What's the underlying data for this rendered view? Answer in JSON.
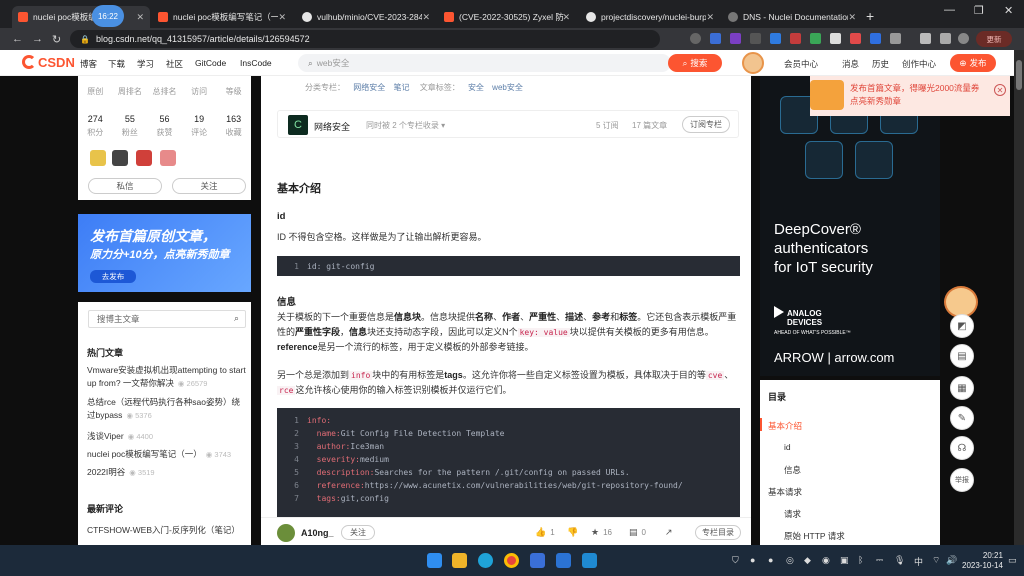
{
  "browser": {
    "tabs": [
      {
        "label": "nuclei poc模板编写笔记",
        "active": true
      },
      {
        "label": "nuclei poc模板编写笔记（一）"
      },
      {
        "label": "vulhub/minio/CVE-2023-2843"
      },
      {
        "label": "(CVE-2022-30525) Zyxel 防"
      },
      {
        "label": "projectdiscovery/nuclei-burp"
      },
      {
        "label": "DNS - Nuclei Documentation"
      }
    ],
    "tab_time_badge": "16:22",
    "url": "blog.csdn.net/qq_41315957/article/details/126594572",
    "update_button": "更新",
    "new_tab": "+",
    "window_controls": [
      "—",
      "❐",
      "✕"
    ]
  },
  "csdn": {
    "logo": "CSDN",
    "nav": [
      "博客",
      "下载",
      "学习",
      "社区",
      "GitCode",
      "InsCode"
    ],
    "search_placeholder": "web安全",
    "search_button": "搜索",
    "right_nav": [
      "会员中心",
      "消息",
      "历史",
      "创作中心"
    ],
    "publish_button": "发布"
  },
  "profile": {
    "top_stats": [
      {
        "value": "",
        "label": "原创"
      },
      {
        "value": "",
        "label": "周排名"
      },
      {
        "value": "",
        "label": "总排名"
      },
      {
        "value": "",
        "label": "访问"
      },
      {
        "value": "",
        "label": "等级"
      }
    ],
    "stats": [
      {
        "value": "274",
        "label": "积分"
      },
      {
        "value": "55",
        "label": "粉丝"
      },
      {
        "value": "56",
        "label": "获赞"
      },
      {
        "value": "19",
        "label": "评论"
      },
      {
        "value": "163",
        "label": "收藏"
      }
    ],
    "message_button": "私信",
    "follow_button": "关注"
  },
  "left_ad": {
    "line1": "发布首篇原创文章，",
    "line2": "原力分+10分，点亮新秀勋章",
    "button": "去发布"
  },
  "blog_search_placeholder": "搜博主文章",
  "hot_title": "热门文章",
  "hot_articles": [
    {
      "title": "Vmware安装虚拟机出现attempting to start up from? 一文帮你解决",
      "views": "26579"
    },
    {
      "title": "总结rce（远程代码执行各种sao姿势）绕过bypass",
      "views": "5376"
    },
    {
      "title": "浅谈Viper",
      "views": "4400"
    },
    {
      "title": "nuclei poc模板编写笔记（一）",
      "views": "3743"
    },
    {
      "title": "2022I明谷",
      "views": "3519"
    }
  ],
  "latest_comments_title": "最新评论",
  "latest_comment_preview": "CTFSHOW-WEB入门-反序列化（笔记）",
  "article": {
    "category_label": "分类专栏：",
    "categories": [
      "网络安全",
      "笔记"
    ],
    "tags_label": "文章标签：",
    "tags": [
      "安全",
      "web安全"
    ],
    "column_icon": "C",
    "column_name": "网络安全",
    "column_sub": "同时被 2 个专栏收录 ▾",
    "column_subs": "5 订阅",
    "column_articles": "17 篇文章",
    "subscribe_button": "订阅专栏",
    "h_basic": "基本介绍",
    "h_id": "id",
    "p_id": "ID 不得包含空格。这样做是为了让输出解析更容易。",
    "code1_ln": "1",
    "code1": "id: git-config",
    "h_info": "信息",
    "p_info_1": "关于模板的下一个重要信息是",
    "p_info_b1": "信息块",
    "p_info_2": "。信息块提供",
    "p_info_b2": "名称",
    "p_info_3": "、",
    "p_info_b3": "作者",
    "p_info_4": "、",
    "p_info_b4": "严重性",
    "p_info_5": "、",
    "p_info_b5": "描述",
    "p_info_6": "、",
    "p_info_b6": "参考",
    "p_info_7": "和",
    "p_info_b7": "标签",
    "p_info_8": "。它还包含表示模板严重性的",
    "p_info_b8": "严重性字段",
    "p_info_9": "，",
    "p_info_b9": "信息",
    "p_info_10": "块还支持动态字段，因此可以定义N个",
    "p_info_code": "key: value",
    "p_info_11": "块以提供有关模板的更多有用信息。",
    "p_info_b10": "reference",
    "p_info_12": "是另一个流行的标签，用于定义模板的外部参考链接。",
    "p2_1": "另一个总是添加到",
    "p2_code1": "info",
    "p2_2": "块中的有用标签是",
    "p2_b1": "tags",
    "p2_3": "。这允许你将一些自定义标签设置为模板，具体取决于目的等",
    "p2_code2": "cve",
    "p2_4": "、",
    "p2_code3": "rce",
    "p2_5": "这允许核心使用你的输入标签识别模板并仅运行它们。",
    "code2": [
      {
        "ln": "1",
        "key": "info:",
        "val": ""
      },
      {
        "ln": "2",
        "key": "  name:",
        "val": " Git Config File Detection Template"
      },
      {
        "ln": "3",
        "key": "  author:",
        "val": " Ice3man"
      },
      {
        "ln": "4",
        "key": "  severity:",
        "val": " medium"
      },
      {
        "ln": "5",
        "key": "  description:",
        "val": " Searches for the pattern /.git/config on passed URLs."
      },
      {
        "ln": "6",
        "key": "  reference:",
        "val": " https://www.acunetix.com/vulnerabilities/web/git-repository-found/"
      },
      {
        "ln": "7",
        "key": "  tags:",
        "val": " git,config"
      }
    ],
    "author": "A10ng_",
    "author_follow": "关注",
    "likes": "1",
    "stars": "16",
    "comments": "0",
    "toc_button": "专栏目录"
  },
  "right_ad": {
    "line1": "DeepCover®",
    "line2": "authenticators",
    "line3": "for IoT security",
    "brand1": "ANALOG",
    "brand2": "DEVICES",
    "tagline": "AHEAD OF WHAT'S POSSIBLE™",
    "arrow": "ARROW | arrow.com"
  },
  "notify": {
    "text": "发布首篇文章，得曝光2000流量券 点亮新秀勋章"
  },
  "toc": {
    "title": "目录",
    "items": [
      "基本介绍",
      "id",
      "信息",
      "基本请求",
      "请求",
      "原始 HTTP 请求"
    ]
  },
  "sidetools": {
    "back_top": "举报"
  },
  "taskbar": {
    "time": "20:21",
    "date": "2023-10-14",
    "ime": "中"
  }
}
